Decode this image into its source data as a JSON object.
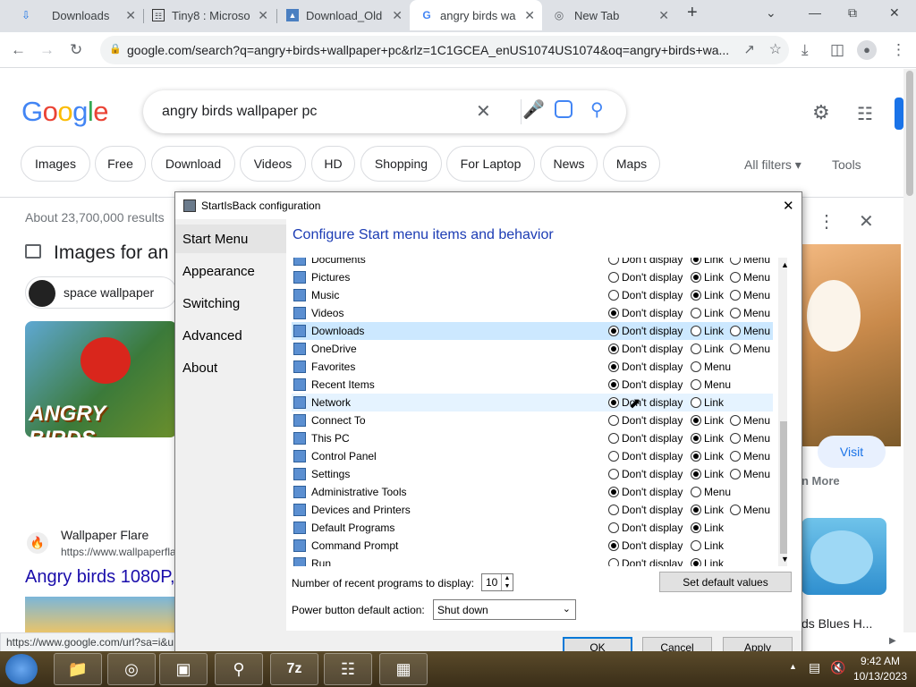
{
  "browser": {
    "tabs": [
      {
        "label": "Downloads",
        "icon": "download-icon"
      },
      {
        "label": "Tiny8 : Microso",
        "icon": "archive-icon"
      },
      {
        "label": "Download_Old",
        "icon": "image-icon"
      },
      {
        "label": "angry birds wa",
        "icon": "google-icon"
      },
      {
        "label": "New Tab",
        "icon": "chrome-icon"
      }
    ],
    "new_tab": "+",
    "url": "google.com/search?q=angry+birds+wallpaper+pc&rlz=1C1GCEA_enUS1074US1074&oq=angry+birds+wa..."
  },
  "google": {
    "logo": "Google",
    "query": "angry birds wallpaper pc",
    "chips": [
      "Images",
      "Free",
      "Download",
      "Videos",
      "HD",
      "Shopping",
      "For Laptop",
      "News",
      "Maps"
    ],
    "all_filters": "All filters",
    "tools": "Tools",
    "result_count": "About 23,700,000 results",
    "images_heading": "Images for an",
    "suggestion_chip": "space wallpaper",
    "source_name": "Wallpaper Flare",
    "source_url": "https://www.wallpaperfla",
    "result_title": "Angry birds 1080P,",
    "visit": "Visit",
    "more": "n More",
    "side_caption": "ds Blues H...",
    "status_url": "https://www.google.com/url?sa=i&u"
  },
  "dialog": {
    "title": "StartIsBack configuration",
    "sidebar": [
      "Start Menu",
      "Appearance",
      "Switching",
      "Advanced",
      "About"
    ],
    "heading": "Configure Start menu items and behavior",
    "opt_dont": "Don't display",
    "opt_link": "Link",
    "opt_menu": "Menu",
    "items": [
      {
        "label": "Documents",
        "icon": "documents-icon",
        "options": [
          "dont",
          "link",
          "menu"
        ],
        "selected": "link"
      },
      {
        "label": "Pictures",
        "icon": "pictures-icon",
        "options": [
          "dont",
          "link",
          "menu"
        ],
        "selected": "link"
      },
      {
        "label": "Music",
        "icon": "music-icon",
        "options": [
          "dont",
          "link",
          "menu"
        ],
        "selected": "link"
      },
      {
        "label": "Videos",
        "icon": "videos-icon",
        "options": [
          "dont",
          "link",
          "menu"
        ],
        "selected": "dont"
      },
      {
        "label": "Downloads",
        "icon": "downloads-icon",
        "options": [
          "dont",
          "link",
          "menu"
        ],
        "selected": "dont"
      },
      {
        "label": "OneDrive",
        "icon": "onedrive-icon",
        "options": [
          "dont",
          "link",
          "menu"
        ],
        "selected": "dont"
      },
      {
        "label": "Favorites",
        "icon": "favorites-icon",
        "options": [
          "dont",
          "menu"
        ],
        "selected": "dont"
      },
      {
        "label": "Recent Items",
        "icon": "recent-items-icon",
        "options": [
          "dont",
          "menu"
        ],
        "selected": "dont"
      },
      {
        "label": "Network",
        "icon": "network-icon",
        "options": [
          "dont",
          "link"
        ],
        "selected": "dont"
      },
      {
        "label": "Connect To",
        "icon": "connect-to-icon",
        "options": [
          "dont",
          "link",
          "menu"
        ],
        "selected": "link"
      },
      {
        "label": "This PC",
        "icon": "this-pc-icon",
        "options": [
          "dont",
          "link",
          "menu"
        ],
        "selected": "link"
      },
      {
        "label": "Control Panel",
        "icon": "control-panel-icon",
        "options": [
          "dont",
          "link",
          "menu"
        ],
        "selected": "link"
      },
      {
        "label": "Settings",
        "icon": "settings-icon",
        "options": [
          "dont",
          "link",
          "menu"
        ],
        "selected": "link"
      },
      {
        "label": "Administrative Tools",
        "icon": "admin-tools-icon",
        "options": [
          "dont",
          "menu"
        ],
        "selected": "dont"
      },
      {
        "label": "Devices and Printers",
        "icon": "devices-printers-icon",
        "options": [
          "dont",
          "link",
          "menu"
        ],
        "selected": "link"
      },
      {
        "label": "Default Programs",
        "icon": "default-programs-icon",
        "options": [
          "dont",
          "link"
        ],
        "selected": "link"
      },
      {
        "label": "Command Prompt",
        "icon": "command-prompt-icon",
        "options": [
          "dont",
          "link"
        ],
        "selected": "dont"
      },
      {
        "label": "Run",
        "icon": "run-icon",
        "options": [
          "dont",
          "link"
        ],
        "selected": "link"
      }
    ],
    "recent_label": "Number of recent programs to display:",
    "recent_value": "10",
    "power_label": "Power button default action:",
    "power_value": "Shut down",
    "set_default": "Set default values",
    "ok": "OK",
    "cancel": "Cancel",
    "apply": "Apply"
  },
  "taskbar": {
    "time": "9:42 AM",
    "date": "10/13/2023",
    "items": [
      "start-orb",
      "file-explorer",
      "chrome",
      "virtualbox",
      "network-app",
      "7zip",
      "tiny8-installer",
      "server-app"
    ]
  },
  "colors": {
    "accent": "#1a73e8",
    "dialog_heading": "#1c3cb4",
    "selection": "#cce8ff"
  }
}
